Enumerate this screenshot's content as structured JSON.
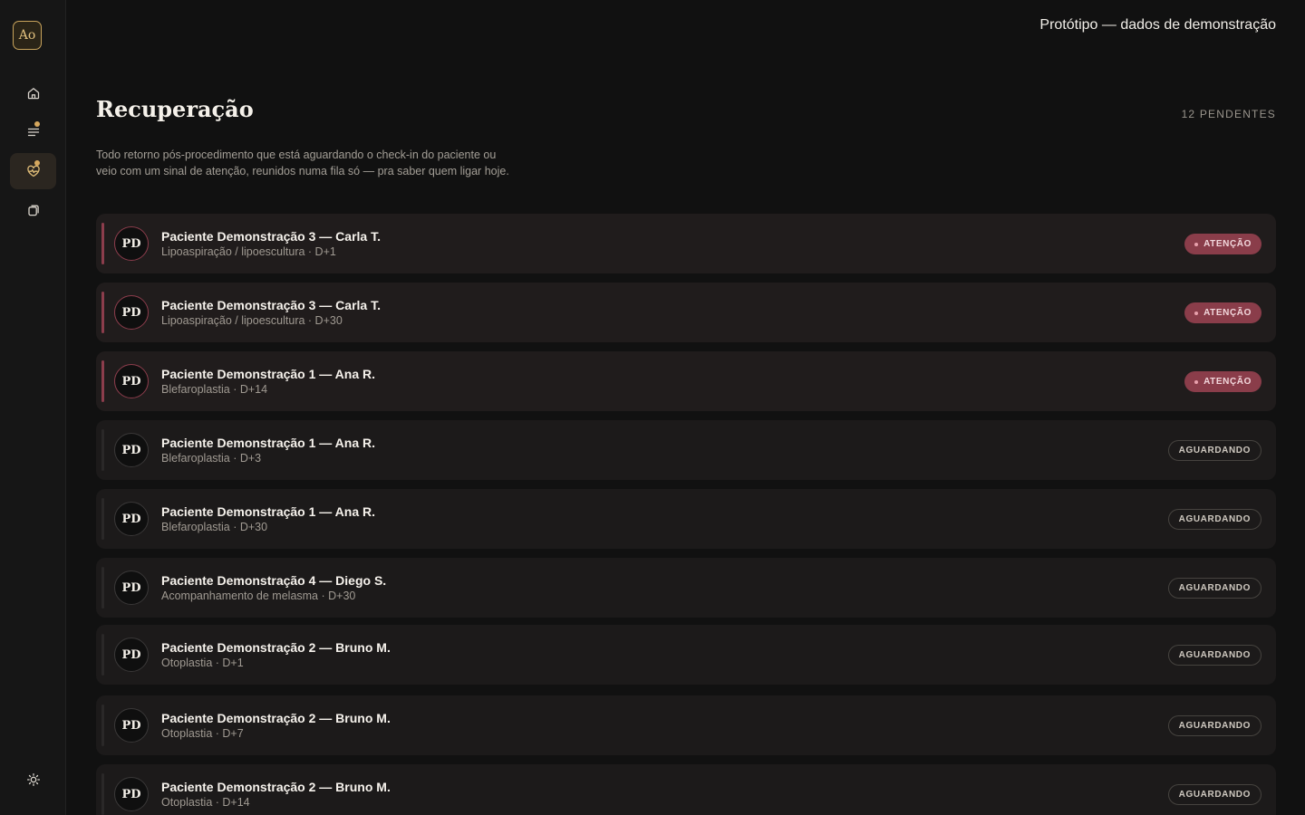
{
  "sidebar": {
    "logo": "Ao",
    "nav": [
      {
        "icon": "home-icon",
        "active": false,
        "dot": false
      },
      {
        "icon": "list-icon",
        "active": false,
        "dot": true
      },
      {
        "icon": "heart-pulse-icon",
        "active": true,
        "dot": true
      },
      {
        "icon": "copy-icon",
        "active": false,
        "dot": false
      }
    ],
    "theme_icon": "sun-icon"
  },
  "topbar": {
    "prototype_label": "Protótipo — dados de demonstração"
  },
  "header": {
    "title": "Recuperação",
    "pending_count": "12 PENDENTES",
    "description": "Todo retorno pós-procedimento que está aguardando o check-in do paciente ou veio com um sinal de atenção, reunidos numa fila só — pra saber quem ligar hoje."
  },
  "colors": {
    "accent": "#c9a45c",
    "attention": "#8a3d4a",
    "background": "#111111"
  },
  "rows": [
    {
      "initials": "PD",
      "name": "Paciente Demonstração 3 — Carla T.",
      "sub": "Lipoaspiração / lipoescultura · D+1",
      "status": "ATENÇÃO",
      "type": "attn"
    },
    {
      "initials": "PD",
      "name": "Paciente Demonstração 3 — Carla T.",
      "sub": "Lipoaspiração / lipoescultura · D+30",
      "status": "ATENÇÃO",
      "type": "attn"
    },
    {
      "initials": "PD",
      "name": "Paciente Demonstração 1 — Ana R.",
      "sub": "Blefaroplastia · D+14",
      "status": "ATENÇÃO",
      "type": "attn"
    },
    {
      "initials": "PD",
      "name": "Paciente Demonstração 1 — Ana R.",
      "sub": "Blefaroplastia · D+3",
      "status": "AGUARDANDO",
      "type": "wait"
    },
    {
      "initials": "PD",
      "name": "Paciente Demonstração 1 — Ana R.",
      "sub": "Blefaroplastia · D+30",
      "status": "AGUARDANDO",
      "type": "wait"
    },
    {
      "initials": "PD",
      "name": "Paciente Demonstração 4 — Diego S.",
      "sub": "Acompanhamento de melasma · D+30",
      "status": "AGUARDANDO",
      "type": "wait"
    },
    {
      "initials": "PD",
      "name": "Paciente Demonstração 2 — Bruno M.",
      "sub": "Otoplastia · D+1",
      "status": "AGUARDANDO",
      "type": "wait"
    },
    {
      "initials": "PD",
      "name": "Paciente Demonstração 2 — Bruno M.",
      "sub": "Otoplastia · D+7",
      "status": "AGUARDANDO",
      "type": "wait"
    },
    {
      "initials": "PD",
      "name": "Paciente Demonstração 2 — Bruno M.",
      "sub": "Otoplastia · D+14",
      "status": "AGUARDANDO",
      "type": "wait"
    }
  ]
}
